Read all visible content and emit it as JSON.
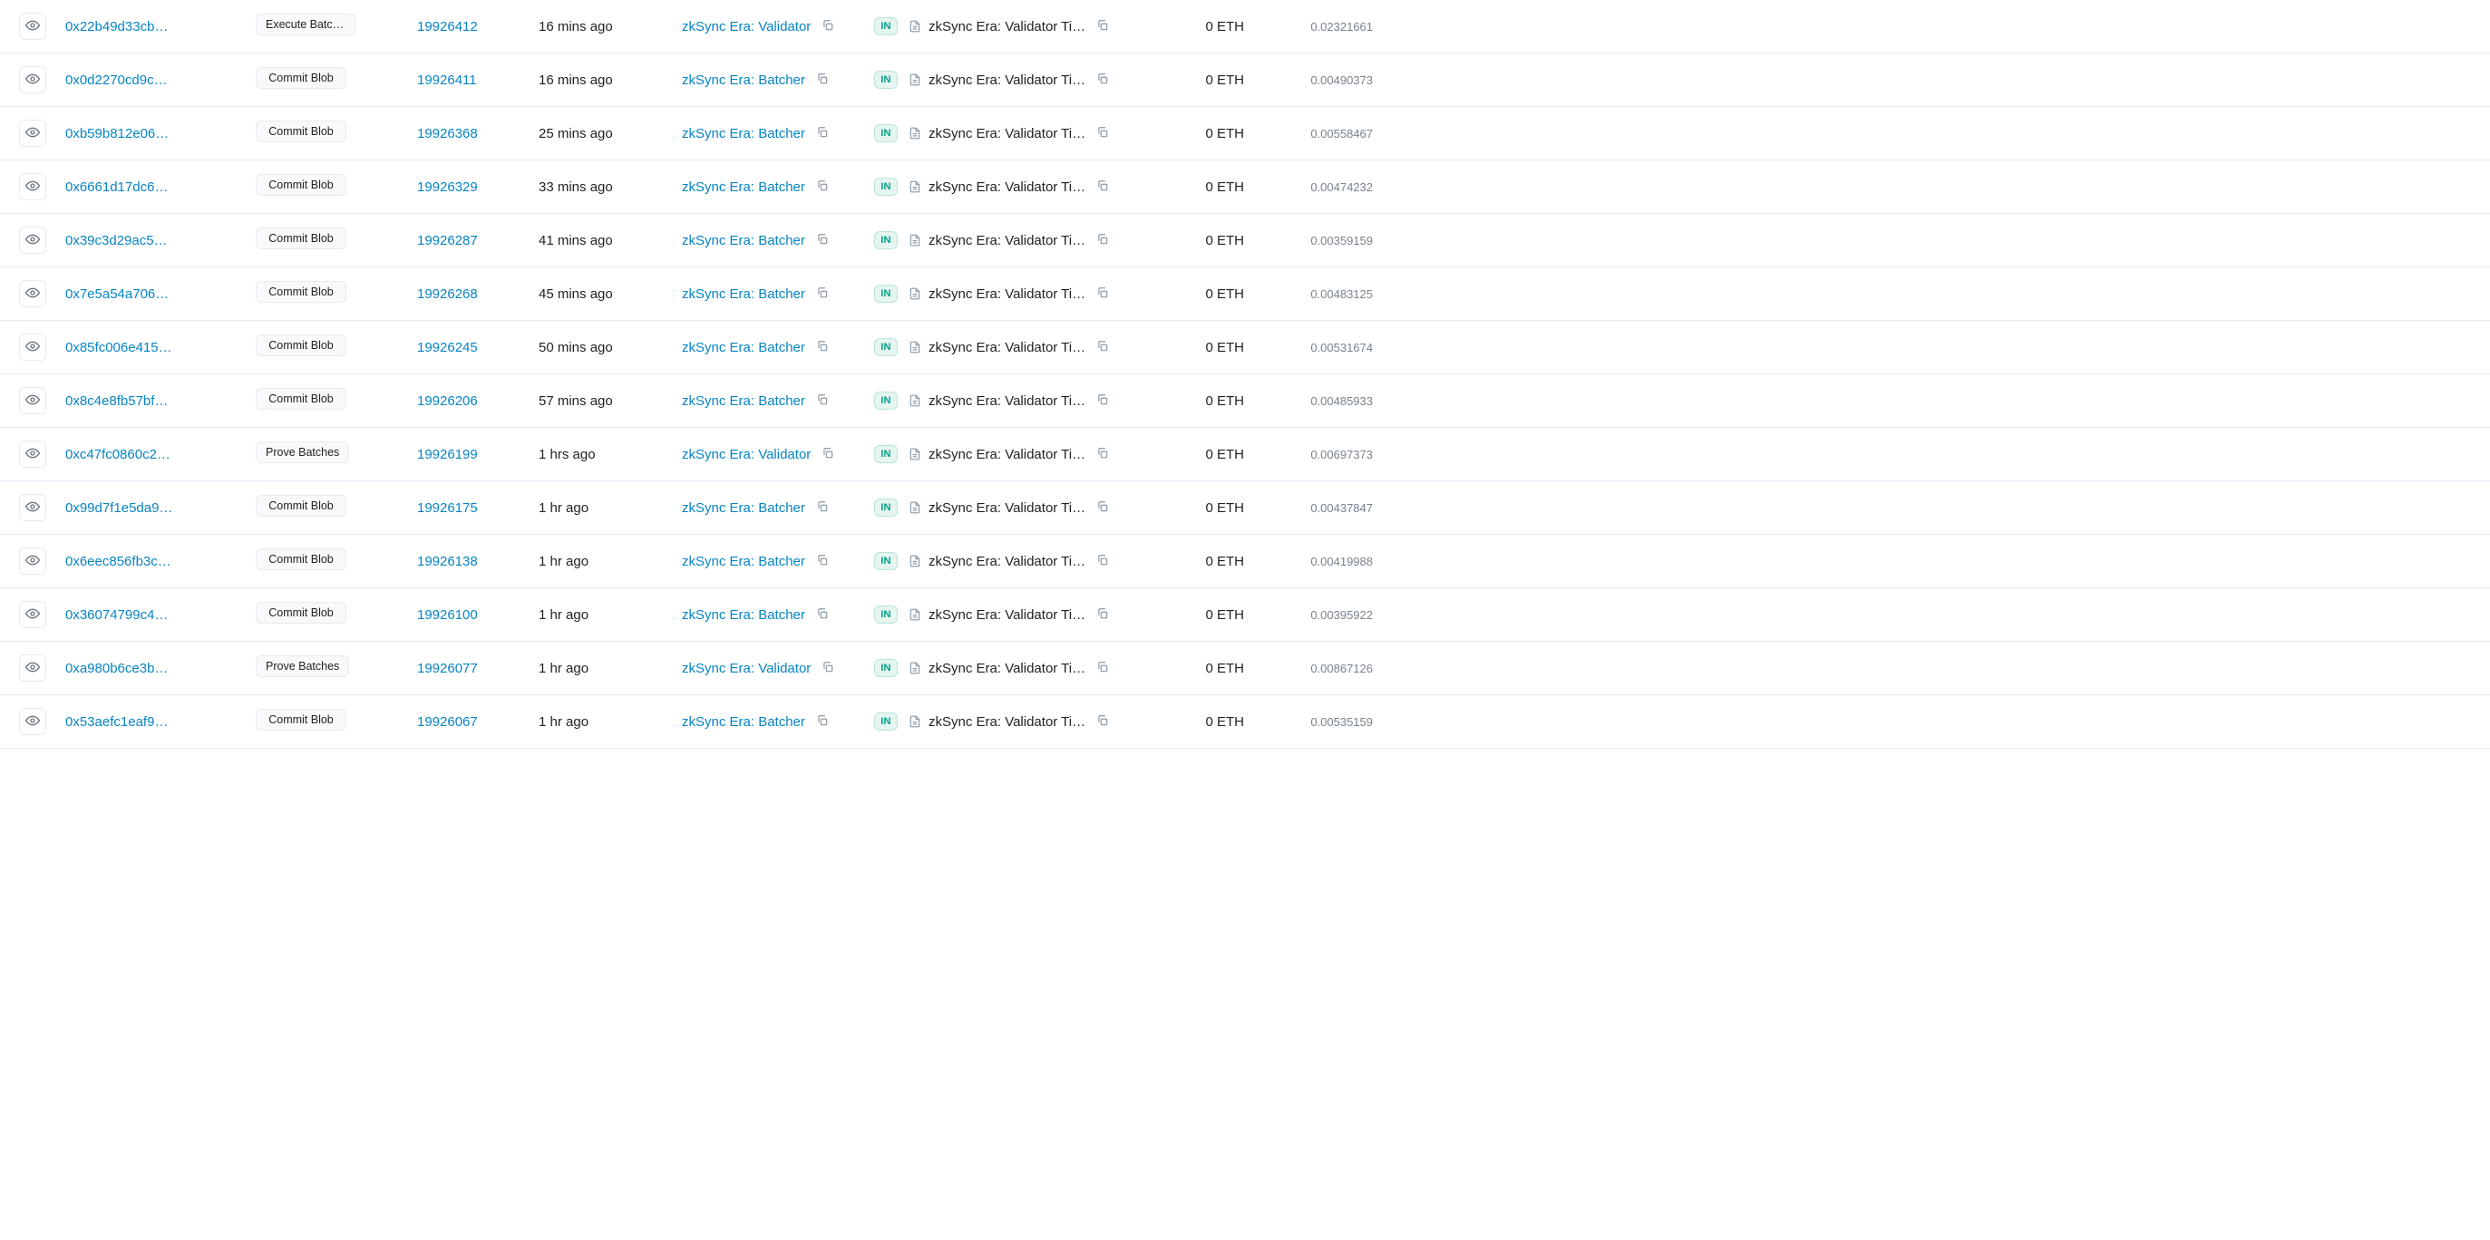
{
  "direction_label": "IN",
  "rows": [
    {
      "hash": "0x22b49d33cb…",
      "method": "Execute Batch…",
      "block": "19926412",
      "age": "16 mins ago",
      "from": "zkSync Era: Validator",
      "to": "zkSync Era: Validator Ti…",
      "value": "0 ETH",
      "fee": "0.02321661"
    },
    {
      "hash": "0x0d2270cd9c…",
      "method": "Commit Blob",
      "block": "19926411",
      "age": "16 mins ago",
      "from": "zkSync Era: Batcher",
      "to": "zkSync Era: Validator Ti…",
      "value": "0 ETH",
      "fee": "0.00490373"
    },
    {
      "hash": "0xb59b812e06…",
      "method": "Commit Blob",
      "block": "19926368",
      "age": "25 mins ago",
      "from": "zkSync Era: Batcher",
      "to": "zkSync Era: Validator Ti…",
      "value": "0 ETH",
      "fee": "0.00558467"
    },
    {
      "hash": "0x6661d17dc6…",
      "method": "Commit Blob",
      "block": "19926329",
      "age": "33 mins ago",
      "from": "zkSync Era: Batcher",
      "to": "zkSync Era: Validator Ti…",
      "value": "0 ETH",
      "fee": "0.00474232"
    },
    {
      "hash": "0x39c3d29ac5…",
      "method": "Commit Blob",
      "block": "19926287",
      "age": "41 mins ago",
      "from": "zkSync Era: Batcher",
      "to": "zkSync Era: Validator Ti…",
      "value": "0 ETH",
      "fee": "0.00359159"
    },
    {
      "hash": "0x7e5a54a706…",
      "method": "Commit Blob",
      "block": "19926268",
      "age": "45 mins ago",
      "from": "zkSync Era: Batcher",
      "to": "zkSync Era: Validator Ti…",
      "value": "0 ETH",
      "fee": "0.00483125"
    },
    {
      "hash": "0x85fc006e415…",
      "method": "Commit Blob",
      "block": "19926245",
      "age": "50 mins ago",
      "from": "zkSync Era: Batcher",
      "to": "zkSync Era: Validator Ti…",
      "value": "0 ETH",
      "fee": "0.00531674"
    },
    {
      "hash": "0x8c4e8fb57bf…",
      "method": "Commit Blob",
      "block": "19926206",
      "age": "57 mins ago",
      "from": "zkSync Era: Batcher",
      "to": "zkSync Era: Validator Ti…",
      "value": "0 ETH",
      "fee": "0.00485933"
    },
    {
      "hash": "0xc47fc0860c2…",
      "method": "Prove Batches",
      "block": "19926199",
      "age": "1 hrs ago",
      "from": "zkSync Era: Validator",
      "to": "zkSync Era: Validator Ti…",
      "value": "0 ETH",
      "fee": "0.00697373"
    },
    {
      "hash": "0x99d7f1e5da9…",
      "method": "Commit Blob",
      "block": "19926175",
      "age": "1 hr ago",
      "from": "zkSync Era: Batcher",
      "to": "zkSync Era: Validator Ti…",
      "value": "0 ETH",
      "fee": "0.00437847"
    },
    {
      "hash": "0x6eec856fb3c…",
      "method": "Commit Blob",
      "block": "19926138",
      "age": "1 hr ago",
      "from": "zkSync Era: Batcher",
      "to": "zkSync Era: Validator Ti…",
      "value": "0 ETH",
      "fee": "0.00419988"
    },
    {
      "hash": "0x36074799c4…",
      "method": "Commit Blob",
      "block": "19926100",
      "age": "1 hr ago",
      "from": "zkSync Era: Batcher",
      "to": "zkSync Era: Validator Ti…",
      "value": "0 ETH",
      "fee": "0.00395922"
    },
    {
      "hash": "0xa980b6ce3b…",
      "method": "Prove Batches",
      "block": "19926077",
      "age": "1 hr ago",
      "from": "zkSync Era: Validator",
      "to": "zkSync Era: Validator Ti…",
      "value": "0 ETH",
      "fee": "0.00867126"
    },
    {
      "hash": "0x53aefc1eaf9…",
      "method": "Commit Blob",
      "block": "19926067",
      "age": "1 hr ago",
      "from": "zkSync Era: Batcher",
      "to": "zkSync Era: Validator Ti…",
      "value": "0 ETH",
      "fee": "0.00535159"
    }
  ]
}
